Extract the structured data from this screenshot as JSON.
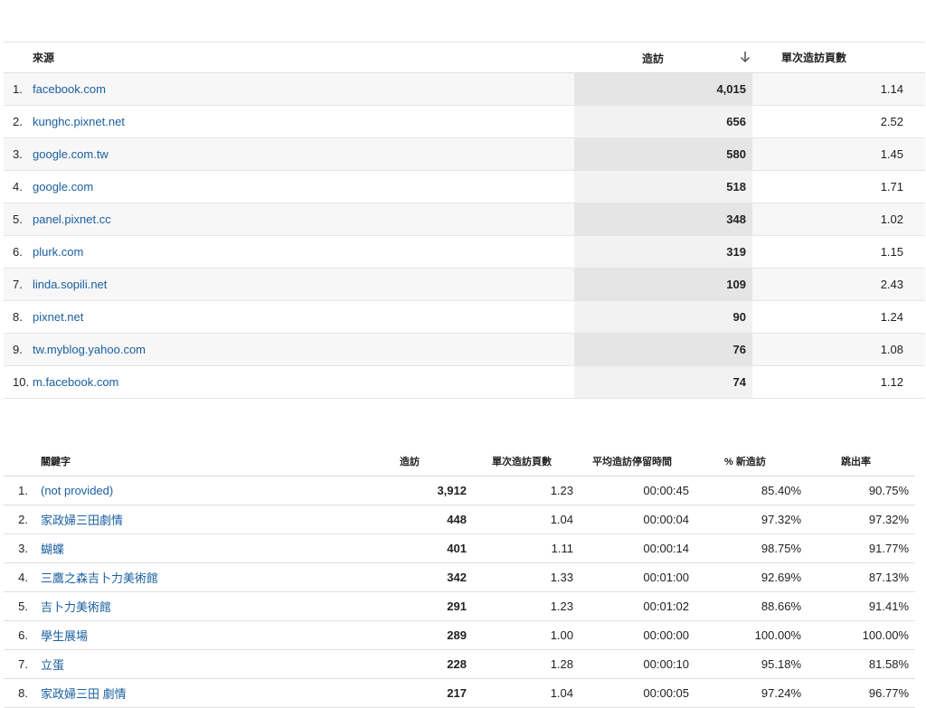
{
  "referrals": {
    "columns": {
      "source": "來源",
      "visits": "造訪",
      "pages_per_visit": "單次造訪頁數"
    },
    "rows": [
      {
        "rank": "1.",
        "source": "facebook.com",
        "visits": "4,015",
        "ppv": "1.14"
      },
      {
        "rank": "2.",
        "source": "kunghc.pixnet.net",
        "visits": "656",
        "ppv": "2.52"
      },
      {
        "rank": "3.",
        "source": "google.com.tw",
        "visits": "580",
        "ppv": "1.45"
      },
      {
        "rank": "4.",
        "source": "google.com",
        "visits": "518",
        "ppv": "1.71"
      },
      {
        "rank": "5.",
        "source": "panel.pixnet.cc",
        "visits": "348",
        "ppv": "1.02"
      },
      {
        "rank": "6.",
        "source": "plurk.com",
        "visits": "319",
        "ppv": "1.15"
      },
      {
        "rank": "7.",
        "source": "linda.sopili.net",
        "visits": "109",
        "ppv": "2.43"
      },
      {
        "rank": "8.",
        "source": "pixnet.net",
        "visits": "90",
        "ppv": "1.24"
      },
      {
        "rank": "9.",
        "source": "tw.myblog.yahoo.com",
        "visits": "76",
        "ppv": "1.08"
      },
      {
        "rank": "10.",
        "source": "m.facebook.com",
        "visits": "74",
        "ppv": "1.12"
      }
    ]
  },
  "keywords": {
    "columns": {
      "keyword": "關鍵字",
      "visits": "造訪",
      "pages_per_visit": "單次造訪頁數",
      "avg_duration": "平均造訪停留時間",
      "new_visits": "% 新造訪",
      "bounce_rate": "跳出率"
    },
    "rows": [
      {
        "rank": "1.",
        "keyword": "(not provided)",
        "visits": "3,912",
        "ppv": "1.23",
        "duration": "00:00:45",
        "new": "85.40%",
        "bounce": "90.75%"
      },
      {
        "rank": "2.",
        "keyword": "家政婦三田劇情",
        "visits": "448",
        "ppv": "1.04",
        "duration": "00:00:04",
        "new": "97.32%",
        "bounce": "97.32%"
      },
      {
        "rank": "3.",
        "keyword": "蝴蝶",
        "visits": "401",
        "ppv": "1.11",
        "duration": "00:00:14",
        "new": "98.75%",
        "bounce": "91.77%"
      },
      {
        "rank": "4.",
        "keyword": "三鷹之森吉卜力美術館",
        "visits": "342",
        "ppv": "1.33",
        "duration": "00:01:00",
        "new": "92.69%",
        "bounce": "87.13%"
      },
      {
        "rank": "5.",
        "keyword": "吉卜力美術館",
        "visits": "291",
        "ppv": "1.23",
        "duration": "00:01:02",
        "new": "88.66%",
        "bounce": "91.41%"
      },
      {
        "rank": "6.",
        "keyword": "學生展場",
        "visits": "289",
        "ppv": "1.00",
        "duration": "00:00:00",
        "new": "100.00%",
        "bounce": "100.00%"
      },
      {
        "rank": "7.",
        "keyword": "立蛋",
        "visits": "228",
        "ppv": "1.28",
        "duration": "00:00:10",
        "new": "95.18%",
        "bounce": "81.58%"
      },
      {
        "rank": "8.",
        "keyword": "家政婦三田 劇情",
        "visits": "217",
        "ppv": "1.04",
        "duration": "00:00:05",
        "new": "97.24%",
        "bounce": "96.77%"
      }
    ]
  },
  "icons": {
    "sort": "arrow-down-icon"
  },
  "colors": {
    "link": "#1a5fa0",
    "highlight_odd": "#e5e5e5",
    "highlight_even": "#f2f2f2"
  }
}
